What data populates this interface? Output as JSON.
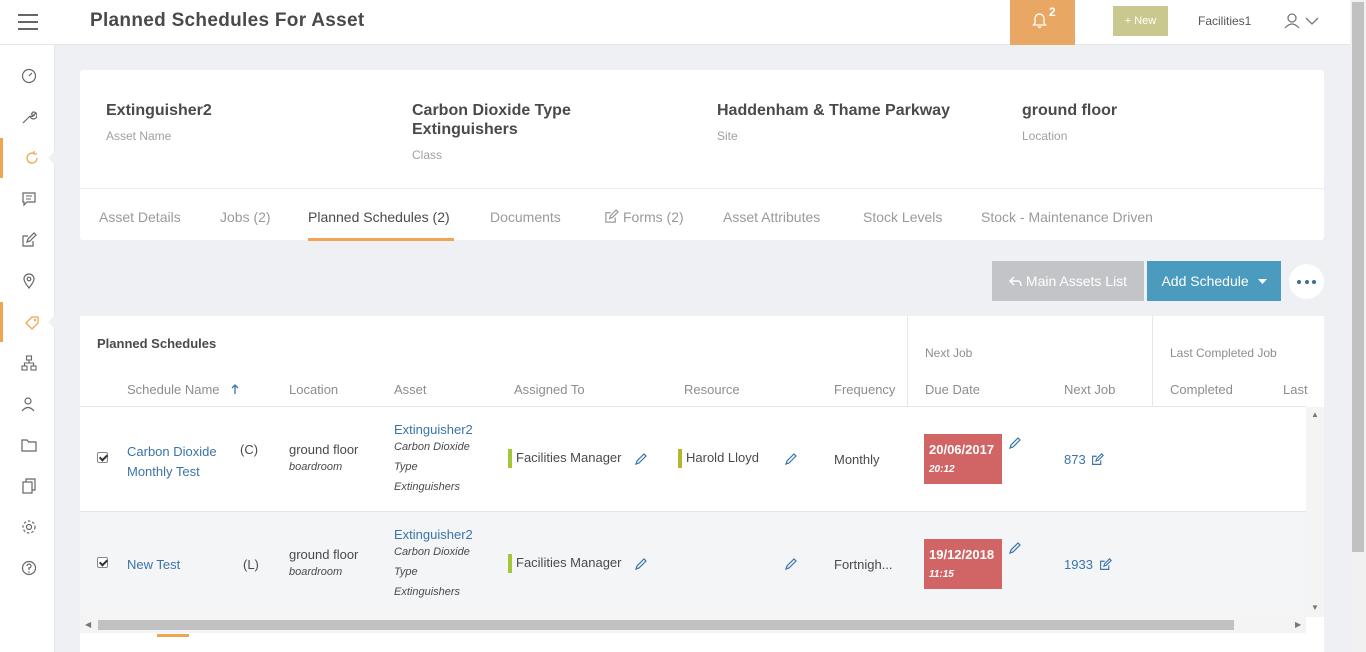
{
  "header": {
    "title": "Planned Schedules For Asset",
    "notifications_count": "2",
    "new_label": "+ New",
    "user": "Facilities1"
  },
  "asset": {
    "fields": [
      {
        "value": "Extinguisher2",
        "label": "Asset Name"
      },
      {
        "value": "Carbon Dioxide Type Extinguishers",
        "label": "Class"
      },
      {
        "value": "Haddenham & Thame Parkway",
        "label": "Site"
      },
      {
        "value": "ground floor",
        "label": "Location"
      }
    ]
  },
  "tabs": [
    {
      "label": "Asset Details"
    },
    {
      "label": "Jobs (2)"
    },
    {
      "label": "Planned Schedules (2)"
    },
    {
      "label": "Documents"
    },
    {
      "label": "Forms (2)"
    },
    {
      "label": "Asset Attributes"
    },
    {
      "label": "Stock Levels"
    },
    {
      "label": "Stock - Maintenance Driven"
    }
  ],
  "actions": {
    "main_assets": "Main Assets List",
    "add_schedule": "Add Schedule"
  },
  "table": {
    "title": "Planned Schedules",
    "group_next_job": "Next Job",
    "group_last_completed": "Last Completed Job",
    "columns": {
      "schedule_name": "Schedule Name",
      "location": "Location",
      "asset": "Asset",
      "assigned_to": "Assigned To",
      "resource": "Resource",
      "frequency": "Frequency",
      "due_date": "Due Date",
      "next_job": "Next Job",
      "completed": "Completed",
      "last": "Last"
    },
    "rows": [
      {
        "name_line1": "Carbon Dioxide",
        "name_line2": "Monthly Test",
        "type": "(C)",
        "location": "ground floor",
        "location_sub": "boardroom",
        "asset": "Extinguisher2",
        "asset_sub1": "Carbon Dioxide",
        "asset_sub2": "Type",
        "asset_sub3": "Extinguishers",
        "assigned_to": "Facilities Manager",
        "resource": "Harold Lloyd",
        "frequency": "Monthly",
        "due_date": "20/06/2017",
        "due_time": "20:12",
        "next_job": "873"
      },
      {
        "name_line1": "New Test",
        "name_line2": "",
        "type": "(L)",
        "location": "ground floor",
        "location_sub": "boardroom",
        "asset": "Extinguisher2",
        "asset_sub1": "Carbon Dioxide",
        "asset_sub2": "Type",
        "asset_sub3": "Extinguishers",
        "assigned_to": "Facilities Manager",
        "resource": "",
        "frequency": "Fortnigh...",
        "due_date": "19/12/2018",
        "due_time": "11:15",
        "next_job": "1933"
      }
    ]
  },
  "colors": {
    "accent": "#f0a550",
    "notify": "#e8a864",
    "primary": "#4b9bbf",
    "overdue": "#d16565",
    "assigned_tag": "#a4c639",
    "resource_tag": "#b5b52e"
  }
}
